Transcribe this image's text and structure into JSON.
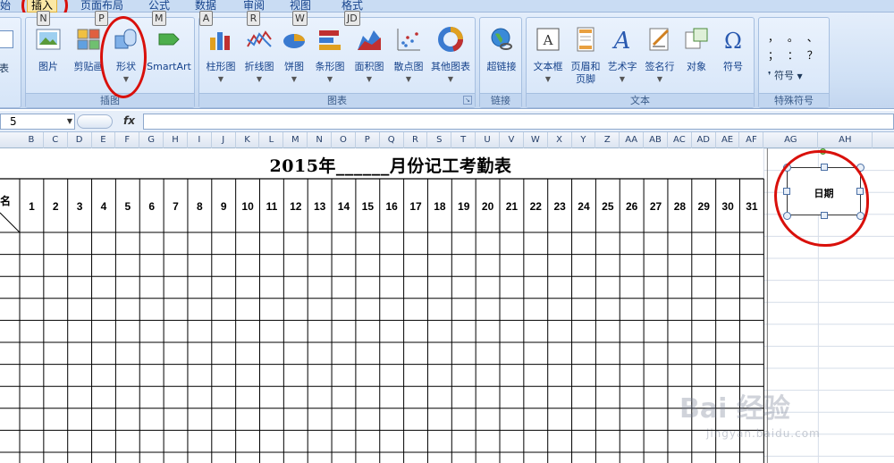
{
  "tabs": [
    {
      "label": "始",
      "key": ""
    },
    {
      "label": "插入",
      "key": "N"
    },
    {
      "label": "页面布局",
      "key": "P"
    },
    {
      "label": "公式",
      "key": "M"
    },
    {
      "label": "数据",
      "key": "A"
    },
    {
      "label": "审阅",
      "key": "R"
    },
    {
      "label": "视图",
      "key": "W"
    },
    {
      "label": "格式",
      "key": "JD"
    }
  ],
  "ribbon": {
    "left_stub": "表",
    "groups": {
      "illustrations": {
        "label": "插图",
        "buttons": {
          "picture": "图片",
          "clipart": "剪贴画",
          "shapes": "形状",
          "smartart": "SmartArt"
        }
      },
      "charts": {
        "label": "图表",
        "buttons": {
          "column": "柱形图",
          "line": "折线图",
          "pie": "饼图",
          "bar": "条形图",
          "area": "面积图",
          "scatter": "散点图",
          "other": "其他图表"
        }
      },
      "links": {
        "label": "链接",
        "buttons": {
          "hyperlink": "超链接"
        }
      },
      "text": {
        "label": "文本",
        "buttons": {
          "textbox": "文本框",
          "header_line1": "页眉和",
          "header_line2": "页脚",
          "wordart": "艺术字",
          "signature": "签名行",
          "object": "对象",
          "symbol": "符号"
        }
      },
      "special": {
        "label": "特殊符号",
        "buttons": {
          "symbol": "符号"
        },
        "glyphs": [
          "，",
          "。",
          "、",
          "；",
          "：",
          "？"
        ]
      }
    }
  },
  "formula_bar": {
    "name_box": "5",
    "fx": "fx",
    "value": ""
  },
  "columns": [
    "B",
    "C",
    "D",
    "E",
    "F",
    "G",
    "H",
    "I",
    "J",
    "K",
    "L",
    "M",
    "N",
    "O",
    "P",
    "Q",
    "R",
    "S",
    "T",
    "U",
    "V",
    "W",
    "X",
    "Y",
    "Z",
    "AA",
    "AB",
    "AC",
    "AD",
    "AE",
    "AF",
    "AG",
    "AH"
  ],
  "sheet": {
    "title": "2015年______月份记工考勤表",
    "name_header_fragment": "名",
    "days": [
      "1",
      "2",
      "3",
      "4",
      "5",
      "6",
      "7",
      "8",
      "9",
      "10",
      "11",
      "12",
      "13",
      "14",
      "15",
      "16",
      "17",
      "18",
      "19",
      "20",
      "21",
      "22",
      "23",
      "24",
      "25",
      "26",
      "27",
      "28",
      "29",
      "30",
      "31"
    ]
  },
  "textbox": {
    "text": "日期"
  },
  "watermark": {
    "brand": "Bai 经验",
    "url": "jingyan.baidu.com"
  },
  "colors": {
    "annotation": "#d9100b",
    "ribbon_text": "#15428b",
    "active_tab": "#fbe8a6"
  }
}
